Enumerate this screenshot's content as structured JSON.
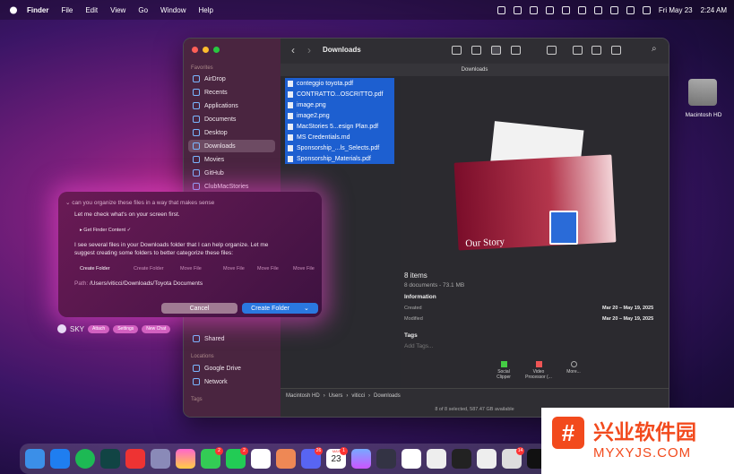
{
  "menubar": {
    "app": "Finder",
    "items": [
      "File",
      "Edit",
      "View",
      "Go",
      "Window",
      "Help"
    ],
    "date": "Fri May 23",
    "time": "2:24 AM"
  },
  "finder": {
    "title": "Downloads",
    "path_header": "Downloads",
    "sidebar": {
      "favorites_label": "Favorites",
      "items": [
        {
          "label": "AirDrop",
          "icon": "airdrop-icon"
        },
        {
          "label": "Recents",
          "icon": "clock-icon"
        },
        {
          "label": "Applications",
          "icon": "applications-icon"
        },
        {
          "label": "Documents",
          "icon": "document-icon"
        },
        {
          "label": "Desktop",
          "icon": "desktop-icon"
        },
        {
          "label": "Downloads",
          "icon": "download-icon"
        },
        {
          "label": "Movies",
          "icon": "film-icon"
        },
        {
          "label": "GitHub",
          "icon": "folder-icon"
        },
        {
          "label": "ClubMacStories",
          "icon": "folder-icon"
        }
      ],
      "icloud_items": [
        {
          "label": "Shared",
          "icon": "shared-folder-icon"
        }
      ],
      "locations_label": "Locations",
      "locations": [
        {
          "label": "Google Drive",
          "icon": "drive-icon"
        },
        {
          "label": "Network",
          "icon": "globe-icon"
        }
      ],
      "tags_label": "Tags"
    },
    "files": [
      "conteggio toyota.pdf",
      "CONTRATTO...OSCRITTO.pdf",
      "image.png",
      "image2.png",
      "MacStories 5...esign Plan.pdf",
      "MS Credentials.md",
      "Sponsorship_...ls_Selects.pdf",
      "Sponsorship_Materials.pdf"
    ],
    "preview": {
      "cover_text": "Our Story",
      "items_title": "8 items",
      "items_sub": "8 documents - 73.1 MB",
      "info_heading": "Information",
      "created_label": "Created",
      "created_value": "Mar 20 – May 19, 2025",
      "modified_label": "Modified",
      "modified_value": "Mar 20 – May 19, 2025",
      "tags_heading": "Tags",
      "tags_placeholder": "Add Tags...",
      "actions": [
        "Social Clipper",
        "Video Processor (...",
        "More..."
      ]
    },
    "pathbar": [
      "Macintosh HD",
      "Users",
      "viticci",
      "Downloads"
    ],
    "status": "8 of 8 selected, 587.47 GB available"
  },
  "assistant": {
    "prompt": "can you organize these files in a way that makes sense",
    "line1": "Let me check what's on your screen first.",
    "tool": "Get Finder Content ✓",
    "line2a": "I see several files in your Downloads folder that I can help organize. Let me",
    "line2b": "suggest creating some folders to better categorize these files:",
    "actions": [
      "Create Folder",
      "Create Folder",
      "Move File",
      "Move File",
      "Move File",
      "Move File"
    ],
    "path_label": "Path:",
    "path_value": "/Users/viticci/Downloads/Toyota Documents",
    "cancel": "Cancel",
    "confirm": "Create Folder",
    "brand": "SKY",
    "pills": [
      "Attach",
      "Settings",
      "New Chat"
    ]
  },
  "desktop": {
    "disk_label": "Macintosh HD"
  },
  "dock": {
    "badges": [
      "2",
      "2",
      "26",
      "1",
      "14"
    ],
    "calendar_day": "23",
    "calendar_month": "MAY"
  },
  "watermark": {
    "brand": "兴业软件园",
    "url": "MYXYJS.COM",
    "mark": "#"
  }
}
